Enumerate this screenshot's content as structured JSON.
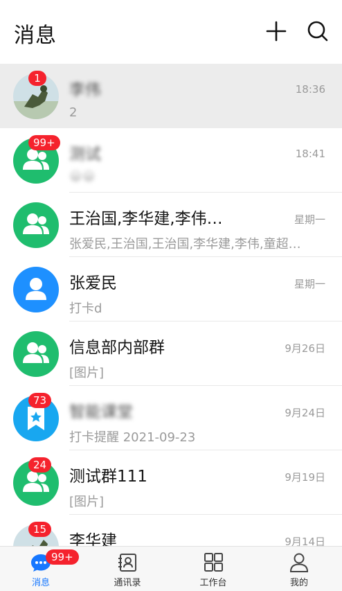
{
  "header": {
    "title": "消息"
  },
  "conversations": [
    {
      "title": "李伟",
      "time": "18:36",
      "subtitle": "2",
      "badge": "1",
      "avatar": "photo-avatar",
      "color": "#c9d7dc"
    },
    {
      "title": "测试",
      "time": "18:41",
      "subtitle": "😀😀",
      "badge": "99+",
      "avatar": "group-icon",
      "color": "#1fbd6e"
    },
    {
      "title": "王治国,李华建,李伟…",
      "time": "星期一",
      "subtitle": "张爱民,王治国,王治国,李华建,李伟,童超…",
      "badge": "",
      "avatar": "group-icon",
      "color": "#1fbd6e"
    },
    {
      "title": "张爱民",
      "time": "星期一",
      "subtitle": "打卡d",
      "badge": "",
      "avatar": "person-icon",
      "color": "#1e90ff"
    },
    {
      "title": "信息部内部群",
      "time": "9月26日",
      "subtitle": "[图片]",
      "badge": "",
      "avatar": "group-icon",
      "color": "#1fbd6e"
    },
    {
      "title": "智能课堂",
      "time": "9月24日",
      "subtitle": "打卡提醒 2021-09-23",
      "badge": "73",
      "avatar": "bookmark-star-icon",
      "color": "#18a7f0"
    },
    {
      "title": "测试群111",
      "time": "9月19日",
      "subtitle": "[图片]",
      "badge": "24",
      "avatar": "group-icon",
      "color": "#1fbd6e"
    },
    {
      "title": "李华建",
      "time": "9月14日",
      "subtitle": "",
      "badge": "15",
      "avatar": "photo-avatar",
      "color": "#c9d7dc"
    }
  ],
  "tabbar": {
    "tabs": [
      {
        "label": "消息",
        "icon": "chat-icon",
        "badge": "99+",
        "active": true
      },
      {
        "label": "通讯录",
        "icon": "contacts-icon",
        "badge": "",
        "active": false
      },
      {
        "label": "工作台",
        "icon": "grid-icon",
        "badge": "",
        "active": false
      },
      {
        "label": "我的",
        "icon": "profile-icon",
        "badge": "",
        "active": false
      }
    ]
  },
  "colors": {
    "accent": "#1677ff",
    "badge": "#f5222d",
    "group_green": "#1fbd6e"
  }
}
